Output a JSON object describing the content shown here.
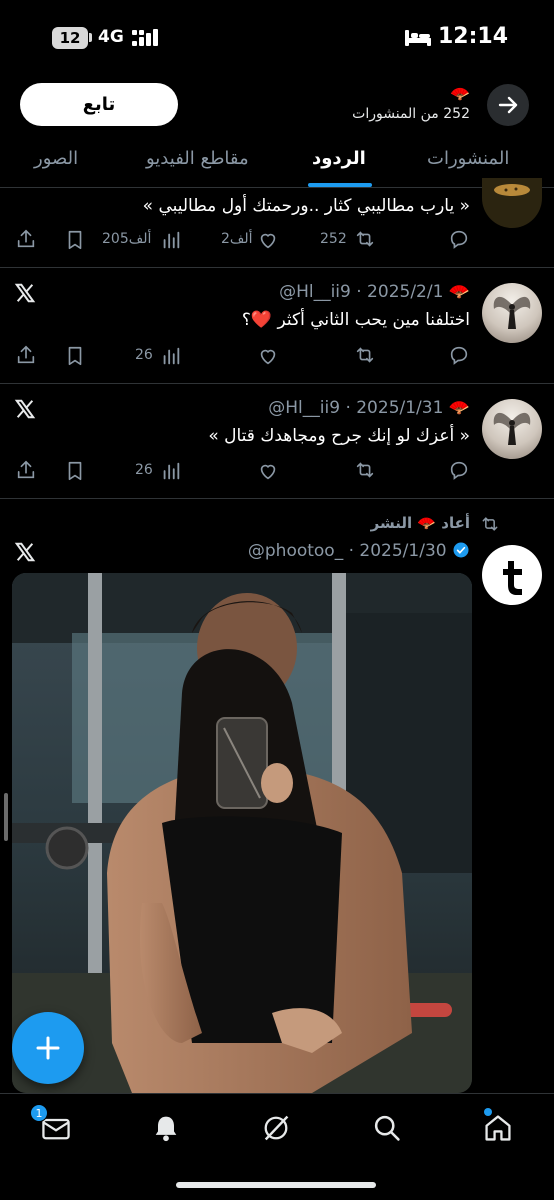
{
  "status_bar": {
    "battery": "12",
    "network": "4G",
    "time": "12:14"
  },
  "header": {
    "follow_label": "تابع",
    "name_emoji": "🪭",
    "post_count_text": "252 من المنشورات"
  },
  "tabs": [
    {
      "label": "المنشورات"
    },
    {
      "label": "الردود"
    },
    {
      "label": "مقاطع الفيديو"
    },
    {
      "label": "الصور"
    }
  ],
  "tweets": [
    {
      "text": "« يارب مطاليبي كثار ..ورحمتك أول مطاليبي »",
      "reposts": "252",
      "likes": "2ألف",
      "views": "205ألف"
    },
    {
      "meta": "@Hl__ii9 · 2025/2/1",
      "name_emoji": "🪭",
      "text": "اختلفنا مين يحب الثاني أكثر ❤️؟",
      "views": "26"
    },
    {
      "meta": "@Hl__ii9 · 2025/1/31",
      "name_emoji": "🪭",
      "text": "« أعزك لو إنك جرح ومجاهدك قتال »",
      "views": "26"
    },
    {
      "repost_label": "أعاد 🪭 النشر",
      "meta": "@phootoo_ · 2025/1/30"
    }
  ],
  "bottom_nav": {
    "messages_badge": "1"
  },
  "colors": {
    "accent": "#1d9bf0",
    "background": "#000000",
    "secondary_text": "#8b98a5"
  }
}
